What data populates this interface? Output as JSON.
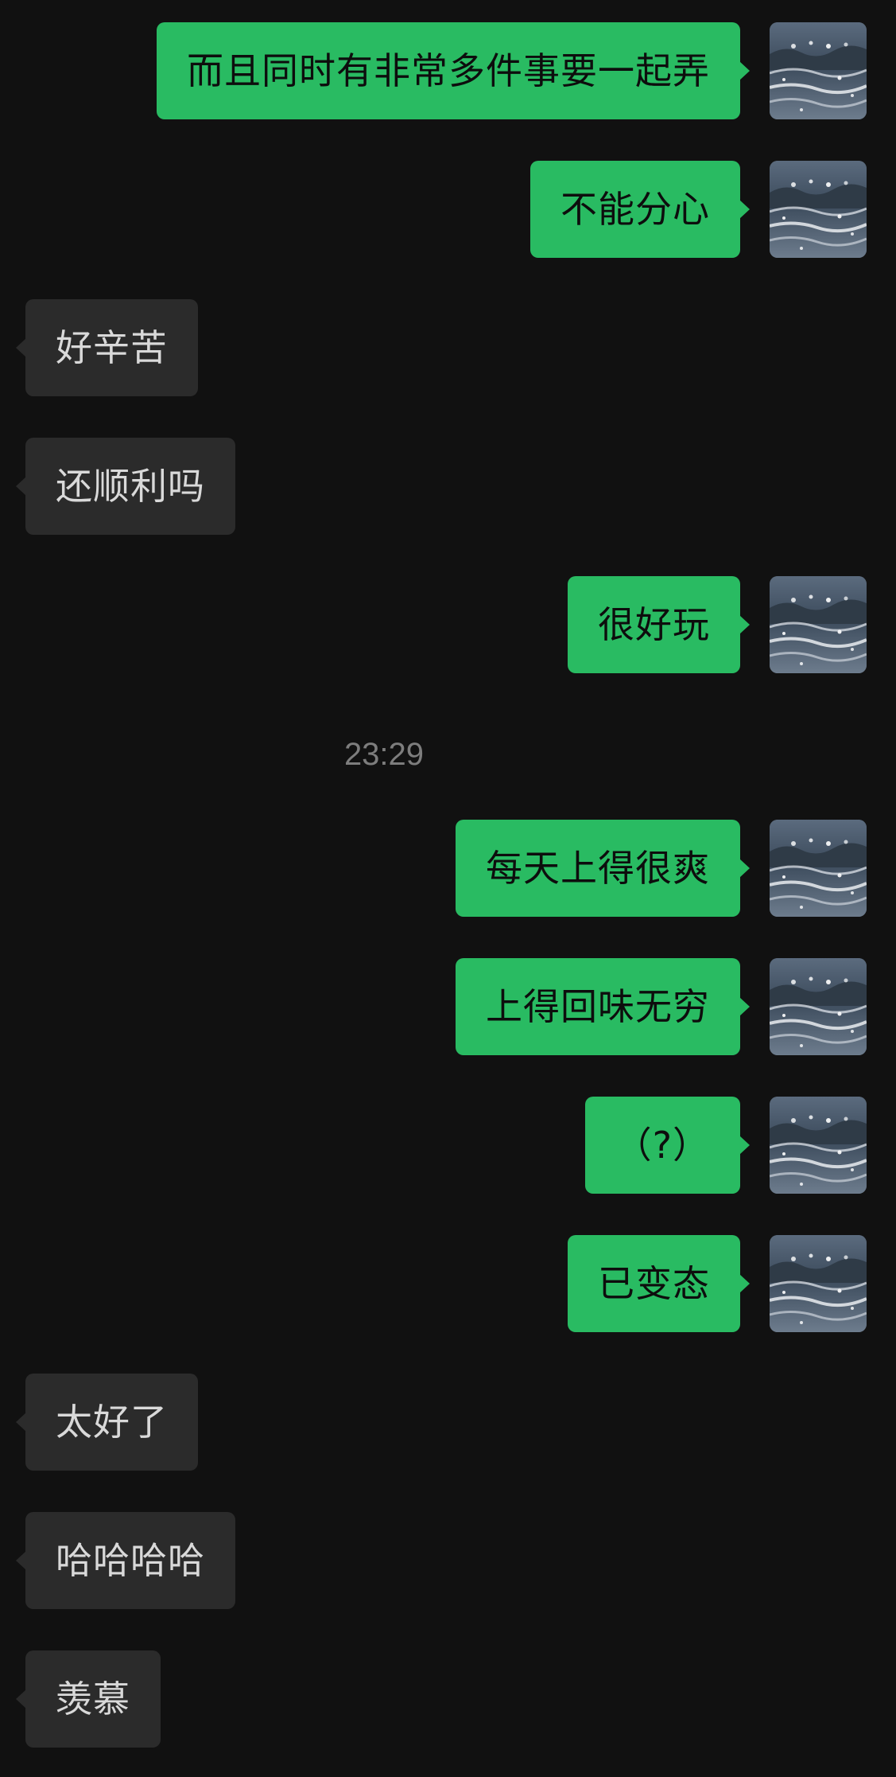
{
  "chat": {
    "messages": [
      {
        "sender": "me",
        "text": "而且同时有非常多件事要一起弄"
      },
      {
        "sender": "me",
        "text": "不能分心"
      },
      {
        "sender": "other",
        "text": "好辛苦"
      },
      {
        "sender": "other",
        "text": "还顺利吗"
      },
      {
        "sender": "me",
        "text": "很好玩"
      },
      {
        "sender": "me",
        "text": "每天上得很爽"
      },
      {
        "sender": "me",
        "text": "上得回味无穷"
      },
      {
        "sender": "me",
        "text": "（?）"
      },
      {
        "sender": "me",
        "text": "已变态"
      },
      {
        "sender": "other",
        "text": "太好了"
      },
      {
        "sender": "other",
        "text": "哈哈哈哈"
      },
      {
        "sender": "other",
        "text": "羡慕"
      }
    ],
    "timestamp": "23:29"
  },
  "avatar": {
    "icon": "sea-wave-photo-icon"
  },
  "colors": {
    "background": "#111111",
    "my_bubble": "#29bb62",
    "other_bubble": "#2b2b2b",
    "timestamp_text": "#7d7d7d"
  }
}
